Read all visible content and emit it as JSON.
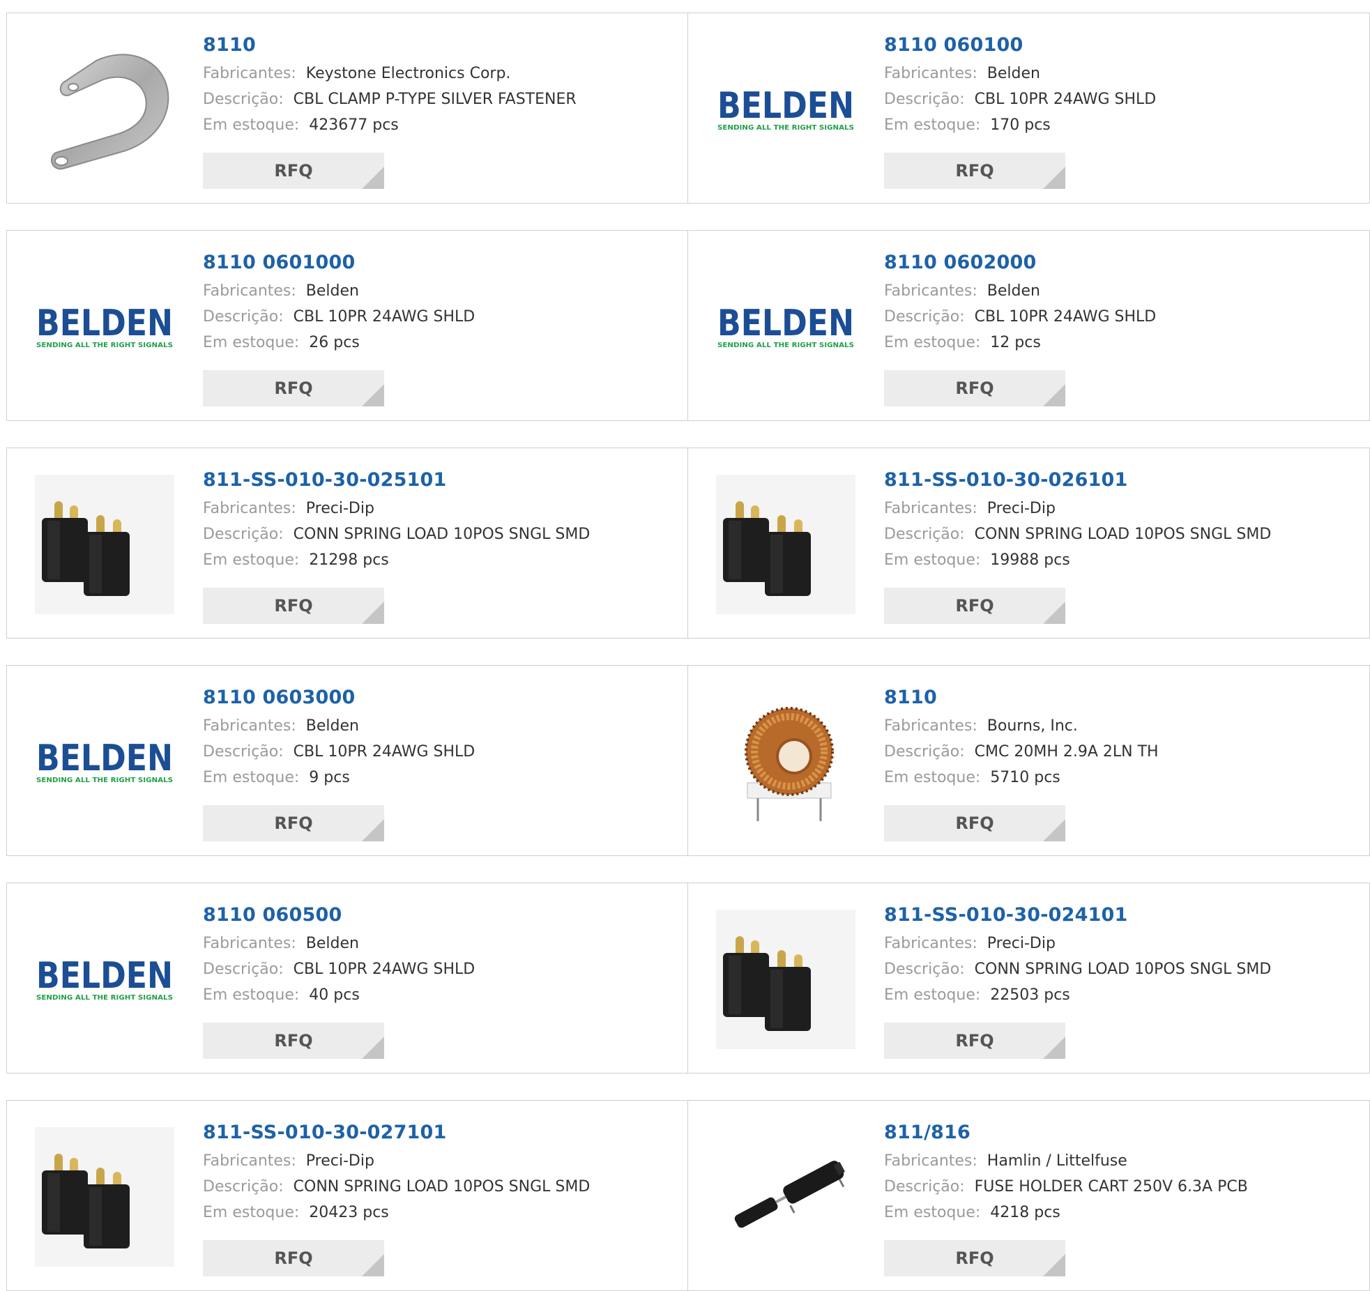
{
  "labels": {
    "manufacturer": "Fabricantes:",
    "description": "Descrição:",
    "stock": "Em estoque:",
    "rfq": "RFQ"
  },
  "colors": {
    "part_number": "#1d62a8",
    "label": "#9a9a9a",
    "value": "#333333",
    "rfq_bg": "#ececec",
    "belden_blue": "#1b4e94",
    "belden_green": "#22a04a"
  },
  "products": [
    {
      "part": "8110",
      "manufacturer": "Keystone Electronics Corp.",
      "description": "CBL CLAMP P-TYPE SILVER FASTENER",
      "stock": "423677 pcs",
      "image": "p-clamp"
    },
    {
      "part": "8110 060100",
      "manufacturer": "Belden",
      "description": "CBL 10PR 24AWG SHLD",
      "stock": "170 pcs",
      "image": "belden-logo"
    },
    {
      "part": "8110 0601000",
      "manufacturer": "Belden",
      "description": "CBL 10PR 24AWG SHLD",
      "stock": "26 pcs",
      "image": "belden-logo"
    },
    {
      "part": "8110 0602000",
      "manufacturer": "Belden",
      "description": "CBL 10PR 24AWG SHLD",
      "stock": "12 pcs",
      "image": "belden-logo"
    },
    {
      "part": "811-SS-010-30-025101",
      "manufacturer": "Preci-Dip",
      "description": "CONN SPRING LOAD 10POS SNGL SMD",
      "stock": "21298 pcs",
      "image": "spring-connector"
    },
    {
      "part": "811-SS-010-30-026101",
      "manufacturer": "Preci-Dip",
      "description": "CONN SPRING LOAD 10POS SNGL SMD",
      "stock": "19988 pcs",
      "image": "spring-connector"
    },
    {
      "part": "8110 0603000",
      "manufacturer": "Belden",
      "description": "CBL 10PR 24AWG SHLD",
      "stock": "9 pcs",
      "image": "belden-logo"
    },
    {
      "part": "8110",
      "manufacturer": "Bourns, Inc.",
      "description": "CMC 20MH 2.9A 2LN TH",
      "stock": "5710 pcs",
      "image": "toroid-choke"
    },
    {
      "part": "8110 060500",
      "manufacturer": "Belden",
      "description": "CBL 10PR 24AWG SHLD",
      "stock": "40 pcs",
      "image": "belden-logo"
    },
    {
      "part": "811-SS-010-30-024101",
      "manufacturer": "Preci-Dip",
      "description": "CONN SPRING LOAD 10POS SNGL SMD",
      "stock": "22503 pcs",
      "image": "spring-connector"
    },
    {
      "part": "811-SS-010-30-027101",
      "manufacturer": "Preci-Dip",
      "description": "CONN SPRING LOAD 10POS SNGL SMD",
      "stock": "20423 pcs",
      "image": "spring-connector"
    },
    {
      "part": "811/816",
      "manufacturer": "Hamlin / Littelfuse",
      "description": "FUSE HOLDER CART 250V 6.3A PCB",
      "stock": "4218 pcs",
      "image": "fuse-holder"
    }
  ],
  "belden_logo": {
    "word": "BELDEN",
    "tagline": "SENDING ALL THE RIGHT SIGNALS"
  }
}
